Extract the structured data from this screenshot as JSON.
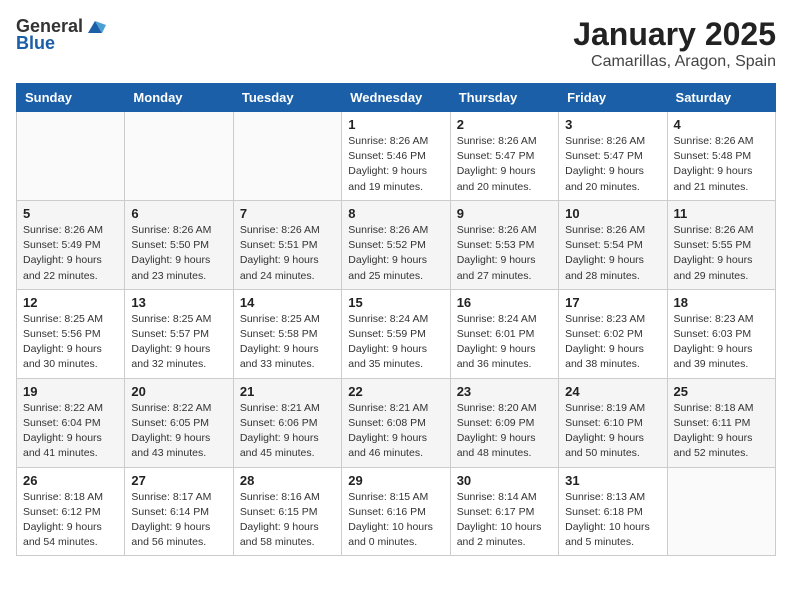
{
  "header": {
    "logo_general": "General",
    "logo_blue": "Blue",
    "title": "January 2025",
    "subtitle": "Camarillas, Aragon, Spain"
  },
  "weekdays": [
    "Sunday",
    "Monday",
    "Tuesday",
    "Wednesday",
    "Thursday",
    "Friday",
    "Saturday"
  ],
  "weeks": [
    [
      {
        "day": "",
        "sunrise": "",
        "sunset": "",
        "daylight": ""
      },
      {
        "day": "",
        "sunrise": "",
        "sunset": "",
        "daylight": ""
      },
      {
        "day": "",
        "sunrise": "",
        "sunset": "",
        "daylight": ""
      },
      {
        "day": "1",
        "sunrise": "Sunrise: 8:26 AM",
        "sunset": "Sunset: 5:46 PM",
        "daylight": "Daylight: 9 hours and 19 minutes."
      },
      {
        "day": "2",
        "sunrise": "Sunrise: 8:26 AM",
        "sunset": "Sunset: 5:47 PM",
        "daylight": "Daylight: 9 hours and 20 minutes."
      },
      {
        "day": "3",
        "sunrise": "Sunrise: 8:26 AM",
        "sunset": "Sunset: 5:47 PM",
        "daylight": "Daylight: 9 hours and 20 minutes."
      },
      {
        "day": "4",
        "sunrise": "Sunrise: 8:26 AM",
        "sunset": "Sunset: 5:48 PM",
        "daylight": "Daylight: 9 hours and 21 minutes."
      }
    ],
    [
      {
        "day": "5",
        "sunrise": "Sunrise: 8:26 AM",
        "sunset": "Sunset: 5:49 PM",
        "daylight": "Daylight: 9 hours and 22 minutes."
      },
      {
        "day": "6",
        "sunrise": "Sunrise: 8:26 AM",
        "sunset": "Sunset: 5:50 PM",
        "daylight": "Daylight: 9 hours and 23 minutes."
      },
      {
        "day": "7",
        "sunrise": "Sunrise: 8:26 AM",
        "sunset": "Sunset: 5:51 PM",
        "daylight": "Daylight: 9 hours and 24 minutes."
      },
      {
        "day": "8",
        "sunrise": "Sunrise: 8:26 AM",
        "sunset": "Sunset: 5:52 PM",
        "daylight": "Daylight: 9 hours and 25 minutes."
      },
      {
        "day": "9",
        "sunrise": "Sunrise: 8:26 AM",
        "sunset": "Sunset: 5:53 PM",
        "daylight": "Daylight: 9 hours and 27 minutes."
      },
      {
        "day": "10",
        "sunrise": "Sunrise: 8:26 AM",
        "sunset": "Sunset: 5:54 PM",
        "daylight": "Daylight: 9 hours and 28 minutes."
      },
      {
        "day": "11",
        "sunrise": "Sunrise: 8:26 AM",
        "sunset": "Sunset: 5:55 PM",
        "daylight": "Daylight: 9 hours and 29 minutes."
      }
    ],
    [
      {
        "day": "12",
        "sunrise": "Sunrise: 8:25 AM",
        "sunset": "Sunset: 5:56 PM",
        "daylight": "Daylight: 9 hours and 30 minutes."
      },
      {
        "day": "13",
        "sunrise": "Sunrise: 8:25 AM",
        "sunset": "Sunset: 5:57 PM",
        "daylight": "Daylight: 9 hours and 32 minutes."
      },
      {
        "day": "14",
        "sunrise": "Sunrise: 8:25 AM",
        "sunset": "Sunset: 5:58 PM",
        "daylight": "Daylight: 9 hours and 33 minutes."
      },
      {
        "day": "15",
        "sunrise": "Sunrise: 8:24 AM",
        "sunset": "Sunset: 5:59 PM",
        "daylight": "Daylight: 9 hours and 35 minutes."
      },
      {
        "day": "16",
        "sunrise": "Sunrise: 8:24 AM",
        "sunset": "Sunset: 6:01 PM",
        "daylight": "Daylight: 9 hours and 36 minutes."
      },
      {
        "day": "17",
        "sunrise": "Sunrise: 8:23 AM",
        "sunset": "Sunset: 6:02 PM",
        "daylight": "Daylight: 9 hours and 38 minutes."
      },
      {
        "day": "18",
        "sunrise": "Sunrise: 8:23 AM",
        "sunset": "Sunset: 6:03 PM",
        "daylight": "Daylight: 9 hours and 39 minutes."
      }
    ],
    [
      {
        "day": "19",
        "sunrise": "Sunrise: 8:22 AM",
        "sunset": "Sunset: 6:04 PM",
        "daylight": "Daylight: 9 hours and 41 minutes."
      },
      {
        "day": "20",
        "sunrise": "Sunrise: 8:22 AM",
        "sunset": "Sunset: 6:05 PM",
        "daylight": "Daylight: 9 hours and 43 minutes."
      },
      {
        "day": "21",
        "sunrise": "Sunrise: 8:21 AM",
        "sunset": "Sunset: 6:06 PM",
        "daylight": "Daylight: 9 hours and 45 minutes."
      },
      {
        "day": "22",
        "sunrise": "Sunrise: 8:21 AM",
        "sunset": "Sunset: 6:08 PM",
        "daylight": "Daylight: 9 hours and 46 minutes."
      },
      {
        "day": "23",
        "sunrise": "Sunrise: 8:20 AM",
        "sunset": "Sunset: 6:09 PM",
        "daylight": "Daylight: 9 hours and 48 minutes."
      },
      {
        "day": "24",
        "sunrise": "Sunrise: 8:19 AM",
        "sunset": "Sunset: 6:10 PM",
        "daylight": "Daylight: 9 hours and 50 minutes."
      },
      {
        "day": "25",
        "sunrise": "Sunrise: 8:18 AM",
        "sunset": "Sunset: 6:11 PM",
        "daylight": "Daylight: 9 hours and 52 minutes."
      }
    ],
    [
      {
        "day": "26",
        "sunrise": "Sunrise: 8:18 AM",
        "sunset": "Sunset: 6:12 PM",
        "daylight": "Daylight: 9 hours and 54 minutes."
      },
      {
        "day": "27",
        "sunrise": "Sunrise: 8:17 AM",
        "sunset": "Sunset: 6:14 PM",
        "daylight": "Daylight: 9 hours and 56 minutes."
      },
      {
        "day": "28",
        "sunrise": "Sunrise: 8:16 AM",
        "sunset": "Sunset: 6:15 PM",
        "daylight": "Daylight: 9 hours and 58 minutes."
      },
      {
        "day": "29",
        "sunrise": "Sunrise: 8:15 AM",
        "sunset": "Sunset: 6:16 PM",
        "daylight": "Daylight: 10 hours and 0 minutes."
      },
      {
        "day": "30",
        "sunrise": "Sunrise: 8:14 AM",
        "sunset": "Sunset: 6:17 PM",
        "daylight": "Daylight: 10 hours and 2 minutes."
      },
      {
        "day": "31",
        "sunrise": "Sunrise: 8:13 AM",
        "sunset": "Sunset: 6:18 PM",
        "daylight": "Daylight: 10 hours and 5 minutes."
      },
      {
        "day": "",
        "sunrise": "",
        "sunset": "",
        "daylight": ""
      }
    ]
  ]
}
